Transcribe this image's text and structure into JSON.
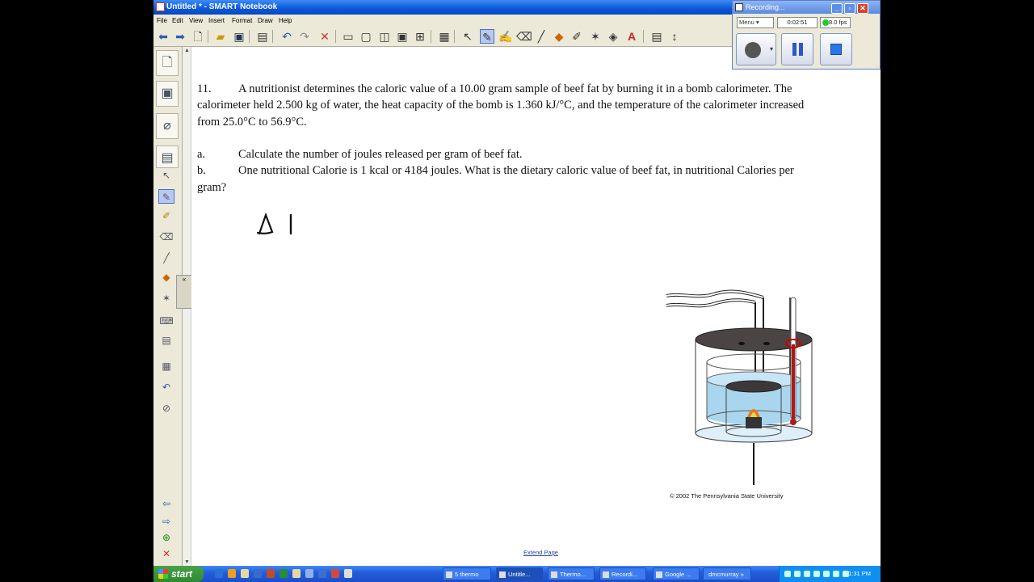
{
  "window": {
    "title": "Untitled * - SMART Notebook"
  },
  "menu": {
    "items": [
      "File",
      "Edit",
      "View",
      "Insert",
      "Format",
      "Draw",
      "Help"
    ]
  },
  "toolbar": {
    "icons": [
      "back-arrow-icon",
      "forward-arrow-icon",
      "add-page-icon",
      "open-folder-icon",
      "save-icon",
      "paste-icon",
      "undo-icon",
      "redo-icon",
      "delete-icon",
      "screen-shade-icon",
      "full-screen-icon",
      "dual-page-icon",
      "screen-capture-icon",
      "document-camera-icon",
      "table-icon",
      "select-icon",
      "pen-icon",
      "creative-pen-icon",
      "eraser-icon",
      "line-icon",
      "shape-icon",
      "magic-pen-icon",
      "fill-icon",
      "text-icon",
      "properties-icon",
      "move-toolbar-icon"
    ]
  },
  "question": {
    "number": "11.",
    "intro_line1": "A nutritionist determines the caloric value of a 10.00 gram sample of beef fat by burning it in a bomb calorimeter.  The",
    "intro_line2": "calorimeter held 2.500 kg of water, the heat capacity of the bomb is 1.360 kJ/°C, and the temperature of the calorimeter increased",
    "intro_line3": "from 25.0°C to 56.9°C.",
    "part_a_label": "a.",
    "part_a_text": "Calculate the number of joules released per gram of beef fat.",
    "part_b_label": "b.",
    "part_b_text": "One nutritional Calorie is 1 kcal or 4184 joules.  What is the dietary caloric value of beef fat, in nutritional Calories per",
    "part_b_cont": "gram?"
  },
  "figure": {
    "copyright": "©  2002  The Pennsylvania State University"
  },
  "extend_page": "Extend Page",
  "recorder": {
    "title": "Recording...",
    "menu_label": "Menu",
    "elapsed": "0:02:51",
    "fps": "8.0 fps"
  },
  "taskbar": {
    "start_label": "start",
    "tasks": [
      "5 thermo",
      "Untitle...",
      "Thermo...",
      "Recordi...",
      "Google ...",
      "dmcmurray"
    ],
    "clock": "1:31 PM"
  }
}
